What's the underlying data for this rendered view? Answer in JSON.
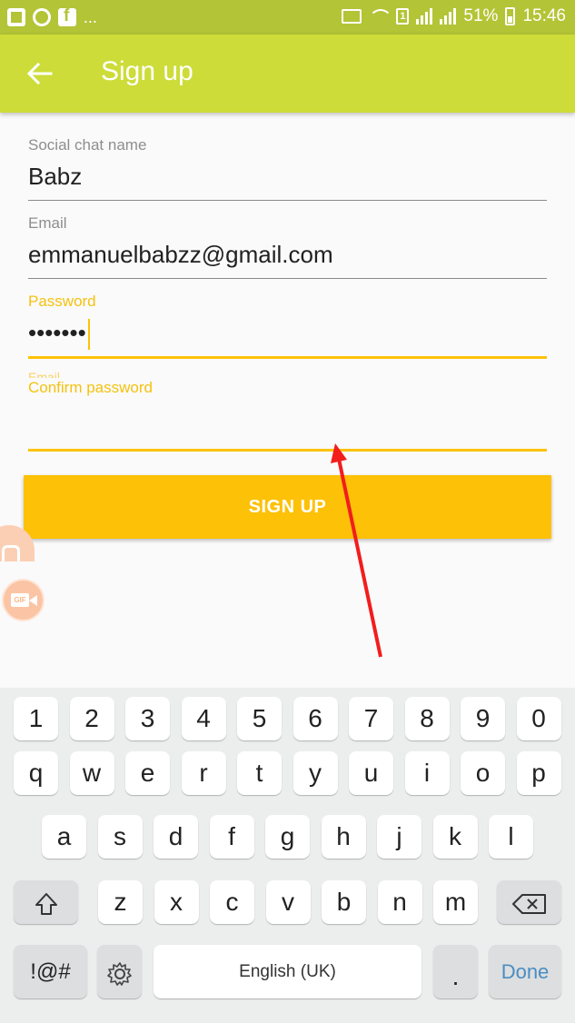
{
  "status_bar": {
    "battery": "51%",
    "time": "15:46",
    "sim_slot": "1",
    "notif_more": "..."
  },
  "app_bar": {
    "title": "Sign up"
  },
  "form": {
    "chat_name": {
      "label": "Social chat name",
      "value": "Babz"
    },
    "email": {
      "label": "Email",
      "value": "emmanuelbabzz@gmail.com"
    },
    "password": {
      "label": "Password",
      "value": "•••••••"
    },
    "ghost_label": "Email",
    "confirm_password": {
      "label": "Confirm password",
      "value": ""
    },
    "submit_label": "SIGN UP"
  },
  "keyboard": {
    "row_numbers": [
      "1",
      "2",
      "3",
      "4",
      "5",
      "6",
      "7",
      "8",
      "9",
      "0"
    ],
    "row_1": [
      "q",
      "w",
      "e",
      "r",
      "t",
      "y",
      "u",
      "i",
      "o",
      "p"
    ],
    "row_2": [
      "a",
      "s",
      "d",
      "f",
      "g",
      "h",
      "j",
      "k",
      "l"
    ],
    "row_3": [
      "z",
      "x",
      "c",
      "v",
      "b",
      "n",
      "m"
    ],
    "symbols_label": "!@#",
    "space_label": "English (UK)",
    "period_label": ".",
    "done_label": "Done"
  },
  "colors": {
    "status_bar": "#b3c436",
    "app_bar": "#cddc39",
    "accent": "#fdc107",
    "annotation_arrow": "#f21d1d"
  }
}
